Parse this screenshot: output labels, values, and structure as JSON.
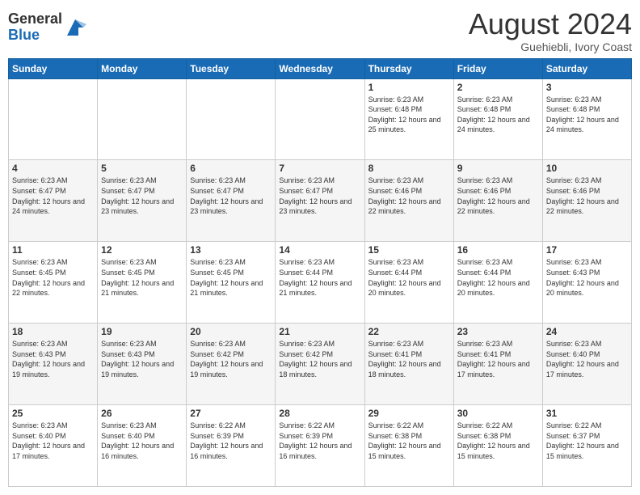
{
  "header": {
    "logo_general": "General",
    "logo_blue": "Blue",
    "month_year": "August 2024",
    "location": "Guehiebli, Ivory Coast"
  },
  "days_of_week": [
    "Sunday",
    "Monday",
    "Tuesday",
    "Wednesday",
    "Thursday",
    "Friday",
    "Saturday"
  ],
  "weeks": [
    [
      {
        "day": "",
        "info": ""
      },
      {
        "day": "",
        "info": ""
      },
      {
        "day": "",
        "info": ""
      },
      {
        "day": "",
        "info": ""
      },
      {
        "day": "1",
        "info": "Sunrise: 6:23 AM\nSunset: 6:48 PM\nDaylight: 12 hours\nand 25 minutes."
      },
      {
        "day": "2",
        "info": "Sunrise: 6:23 AM\nSunset: 6:48 PM\nDaylight: 12 hours\nand 24 minutes."
      },
      {
        "day": "3",
        "info": "Sunrise: 6:23 AM\nSunset: 6:48 PM\nDaylight: 12 hours\nand 24 minutes."
      }
    ],
    [
      {
        "day": "4",
        "info": "Sunrise: 6:23 AM\nSunset: 6:47 PM\nDaylight: 12 hours\nand 24 minutes."
      },
      {
        "day": "5",
        "info": "Sunrise: 6:23 AM\nSunset: 6:47 PM\nDaylight: 12 hours\nand 23 minutes."
      },
      {
        "day": "6",
        "info": "Sunrise: 6:23 AM\nSunset: 6:47 PM\nDaylight: 12 hours\nand 23 minutes."
      },
      {
        "day": "7",
        "info": "Sunrise: 6:23 AM\nSunset: 6:47 PM\nDaylight: 12 hours\nand 23 minutes."
      },
      {
        "day": "8",
        "info": "Sunrise: 6:23 AM\nSunset: 6:46 PM\nDaylight: 12 hours\nand 22 minutes."
      },
      {
        "day": "9",
        "info": "Sunrise: 6:23 AM\nSunset: 6:46 PM\nDaylight: 12 hours\nand 22 minutes."
      },
      {
        "day": "10",
        "info": "Sunrise: 6:23 AM\nSunset: 6:46 PM\nDaylight: 12 hours\nand 22 minutes."
      }
    ],
    [
      {
        "day": "11",
        "info": "Sunrise: 6:23 AM\nSunset: 6:45 PM\nDaylight: 12 hours\nand 22 minutes."
      },
      {
        "day": "12",
        "info": "Sunrise: 6:23 AM\nSunset: 6:45 PM\nDaylight: 12 hours\nand 21 minutes."
      },
      {
        "day": "13",
        "info": "Sunrise: 6:23 AM\nSunset: 6:45 PM\nDaylight: 12 hours\nand 21 minutes."
      },
      {
        "day": "14",
        "info": "Sunrise: 6:23 AM\nSunset: 6:44 PM\nDaylight: 12 hours\nand 21 minutes."
      },
      {
        "day": "15",
        "info": "Sunrise: 6:23 AM\nSunset: 6:44 PM\nDaylight: 12 hours\nand 20 minutes."
      },
      {
        "day": "16",
        "info": "Sunrise: 6:23 AM\nSunset: 6:44 PM\nDaylight: 12 hours\nand 20 minutes."
      },
      {
        "day": "17",
        "info": "Sunrise: 6:23 AM\nSunset: 6:43 PM\nDaylight: 12 hours\nand 20 minutes."
      }
    ],
    [
      {
        "day": "18",
        "info": "Sunrise: 6:23 AM\nSunset: 6:43 PM\nDaylight: 12 hours\nand 19 minutes."
      },
      {
        "day": "19",
        "info": "Sunrise: 6:23 AM\nSunset: 6:43 PM\nDaylight: 12 hours\nand 19 minutes."
      },
      {
        "day": "20",
        "info": "Sunrise: 6:23 AM\nSunset: 6:42 PM\nDaylight: 12 hours\nand 19 minutes."
      },
      {
        "day": "21",
        "info": "Sunrise: 6:23 AM\nSunset: 6:42 PM\nDaylight: 12 hours\nand 18 minutes."
      },
      {
        "day": "22",
        "info": "Sunrise: 6:23 AM\nSunset: 6:41 PM\nDaylight: 12 hours\nand 18 minutes."
      },
      {
        "day": "23",
        "info": "Sunrise: 6:23 AM\nSunset: 6:41 PM\nDaylight: 12 hours\nand 17 minutes."
      },
      {
        "day": "24",
        "info": "Sunrise: 6:23 AM\nSunset: 6:40 PM\nDaylight: 12 hours\nand 17 minutes."
      }
    ],
    [
      {
        "day": "25",
        "info": "Sunrise: 6:23 AM\nSunset: 6:40 PM\nDaylight: 12 hours\nand 17 minutes."
      },
      {
        "day": "26",
        "info": "Sunrise: 6:23 AM\nSunset: 6:40 PM\nDaylight: 12 hours\nand 16 minutes."
      },
      {
        "day": "27",
        "info": "Sunrise: 6:22 AM\nSunset: 6:39 PM\nDaylight: 12 hours\nand 16 minutes."
      },
      {
        "day": "28",
        "info": "Sunrise: 6:22 AM\nSunset: 6:39 PM\nDaylight: 12 hours\nand 16 minutes."
      },
      {
        "day": "29",
        "info": "Sunrise: 6:22 AM\nSunset: 6:38 PM\nDaylight: 12 hours\nand 15 minutes."
      },
      {
        "day": "30",
        "info": "Sunrise: 6:22 AM\nSunset: 6:38 PM\nDaylight: 12 hours\nand 15 minutes."
      },
      {
        "day": "31",
        "info": "Sunrise: 6:22 AM\nSunset: 6:37 PM\nDaylight: 12 hours\nand 15 minutes."
      }
    ]
  ]
}
